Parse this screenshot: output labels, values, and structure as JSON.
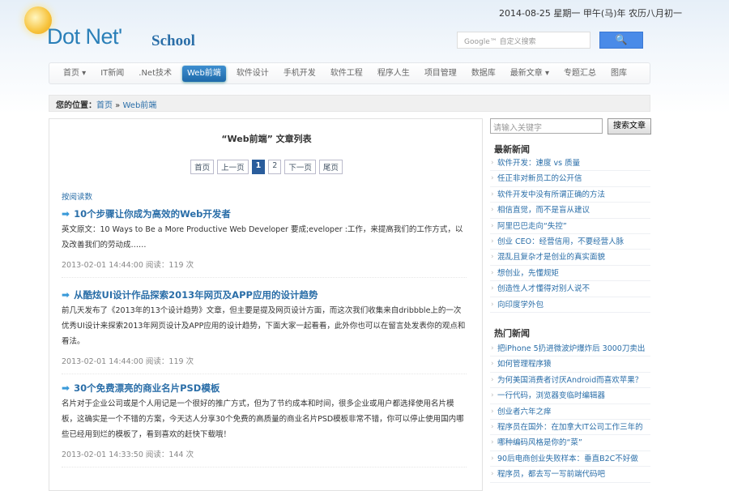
{
  "header": {
    "logo_main": "Dot Net'",
    "logo_sub": "School",
    "date": "2014-08-25 星期一 甲午(马)年 农历八月初一",
    "search_placeholder": "Google™ 自定义搜索",
    "search_button": "🔍"
  },
  "nav": [
    {
      "label": "首页 ▾",
      "icon": "home-icon"
    },
    {
      "label": "IT新闻"
    },
    {
      "label": ".Net技术"
    },
    {
      "label": "Web前端",
      "active": true
    },
    {
      "label": "软件设计"
    },
    {
      "label": "手机开发"
    },
    {
      "label": "软件工程"
    },
    {
      "label": "程序人生"
    },
    {
      "label": "项目管理"
    },
    {
      "label": "数据库"
    },
    {
      "label": "最新文章 ▾"
    },
    {
      "label": "专题汇总"
    },
    {
      "label": "图库"
    }
  ],
  "breadcrumb": {
    "label": "您的位置：",
    "home": "首页",
    "sep": " » ",
    "current": "Web前端"
  },
  "main": {
    "title": "“Web前端” 文章列表",
    "pager": [
      "首页",
      "上一页",
      "1",
      "2",
      "下一页",
      "尾页"
    ],
    "sort": "按阅读数",
    "articles": [
      {
        "title": "10个步骤让你成为高效的Web开发者",
        "desc": "英文原文：10 Ways to Be a More Productive Web Developer 要成;eveloper                                        :工作，来提高我们的工作方式，以及改善我们的劳动成……",
        "meta": "2013-02-01 14:44:00 阅读：119 次"
      },
      {
        "title": "从酷炫UI设计作品探索2013年网页及APP应用的设计趋势",
        "desc": "前几天发布了《2013年的13个设计趋势》文章，但主要是提及网页设计方面，而这次我们收集来自dribbble上的一次优秀UI设计来探索2013年网页设计及APP应用的设计趋势，下面大家一起看看，此外你也可以在留言处发表你的观点和看法。",
        "meta": "2013-02-01 14:44:00 阅读：119 次"
      },
      {
        "title": "30个免费漂亮的商业名片PSD模板",
        "desc": "名片对于企业公司或是个人用记是一个很好的推广方式，但为了节约成本和时间，很多企业或用户都选择使用名片模板，这确实是一个不错的方案，今天达人分享30个免费的高质量的商业名片PSD模板非常不错，你可以停止使用国内哪些已经用到烂的模板了，看到喜欢的赶快下载哦！",
        "meta": "2013-02-01 14:33:50 阅读：144 次"
      }
    ]
  },
  "sidebar": {
    "search_placeholder": "请输入关键字",
    "search_button": "搜索文章",
    "latest_title": "最新新闻",
    "latest": [
      "软件开发：速度 vs 质量",
      "任正非对新员工的公开信",
      "软件开发中没有所谓正确的方法",
      "相信直觉，而不是盲从建议",
      "阿里巴巴走向“失控”",
      "创业 CEO：经营信用，不要经营人脉",
      "混乱且复杂才是创业的真实面貌",
      "想创业，先懂规矩",
      "创造性人才懂得对别人说不",
      "向印度学外包"
    ],
    "hot_title": "热门新闻",
    "hot": [
      "把iPhone 5扔进微波炉爆炸后 3000刀卖出",
      "如何管理程序猿",
      "为何美国消费者讨厌Android而喜欢苹果？",
      "一行代码，浏览器变临时编辑器",
      "创业者六年之痒",
      "程序员在国外：在加拿大IT公司工作三年的",
      "哪种编码风格是你的“菜”",
      "90后电商创业失败样本：垂直B2C不好做",
      "程序员，都去写一写前端代码吧"
    ]
  }
}
